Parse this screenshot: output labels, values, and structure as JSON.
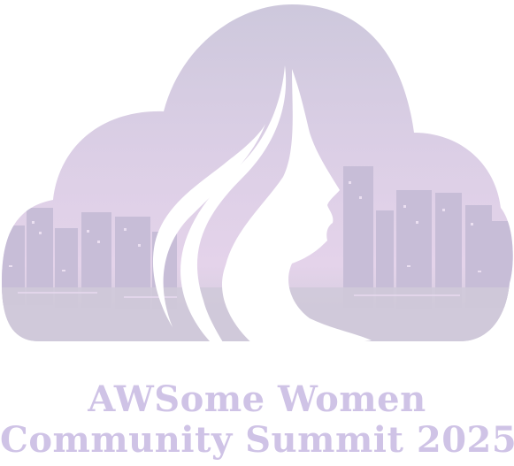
{
  "logo": {
    "title_line1": "AWSome Women",
    "title_line2": "Community Summit 2025",
    "icon": "cloud-city-woman-silhouette-icon"
  },
  "colors": {
    "cloud_top": "#cdc6df",
    "cloud_mid": "#ddcde6",
    "cloud_bottom": "#c9c7d6",
    "city_building": "#c4bcd4",
    "city_window": "#f3e9f7",
    "silhouette": "#ffffff",
    "title_text": "#cfc3e6"
  }
}
